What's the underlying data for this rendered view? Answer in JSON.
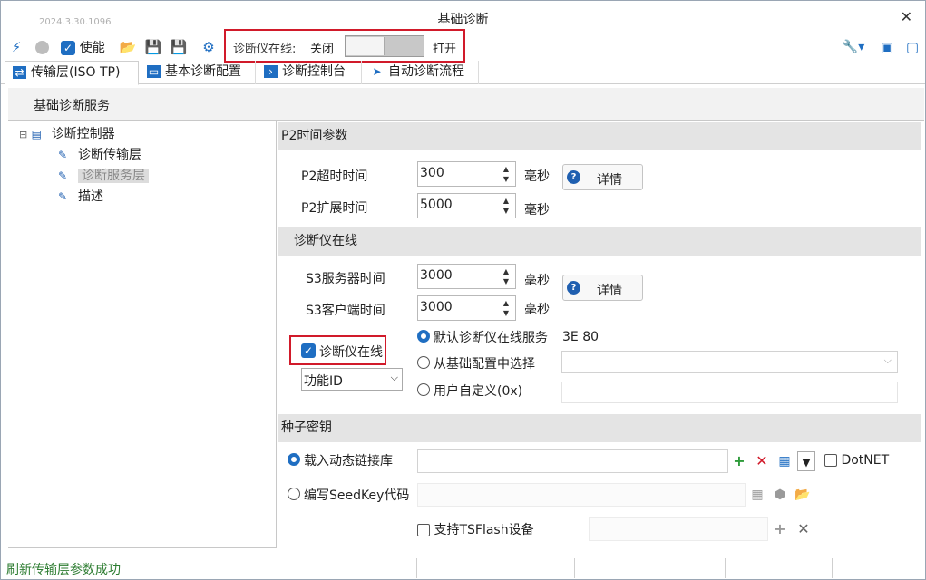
{
  "window": {
    "version": "2024.3.30.1096",
    "title": "基础诊断",
    "close": "✕"
  },
  "toolbar": {
    "enable_label": "使能",
    "online_label": "诊断仪在线:",
    "online_off": "关闭",
    "online_on": "打开"
  },
  "tabs": [
    {
      "label": "传输层(ISO TP)",
      "icon": "transfer-icon"
    },
    {
      "label": "基本诊断配置",
      "icon": "window-icon"
    },
    {
      "label": "诊断控制台",
      "icon": "terminal-icon"
    },
    {
      "label": "自动诊断流程",
      "icon": "send-icon"
    }
  ],
  "group_title": "基础诊断服务",
  "tree": {
    "root": "诊断控制器",
    "children": [
      "诊断传输层",
      "诊断服务层",
      "描述"
    ],
    "selected": "诊断服务层"
  },
  "p2": {
    "section": "P2时间参数",
    "timeout_label": "P2超时时间",
    "timeout_value": "300",
    "ext_label": "P2扩展时间",
    "ext_value": "5000",
    "unit": "毫秒",
    "detail": "详情"
  },
  "tester": {
    "section": "诊断仪在线",
    "s3server_label": "S3服务器时间",
    "s3server_value": "3000",
    "s3client_label": "S3客户端时间",
    "s3client_value": "3000",
    "unit": "毫秒",
    "detail": "详情",
    "enable_label": "诊断仪在线",
    "func_combo": "功能ID",
    "opt_default": "默认诊断仪在线服务",
    "opt_default_value": "3E 80",
    "opt_from_config": "从基础配置中选择",
    "opt_custom": "用户自定义(0x)"
  },
  "seed": {
    "section": "种子密钥",
    "opt_dll": "载入动态链接库",
    "dotnet": "DotNET",
    "opt_code": "编写SeedKey代码",
    "tsflash": "支持TSFlash设备"
  },
  "status": {
    "message": "刷新传输层参数成功"
  },
  "colors": {
    "accent": "#1f6ec2",
    "highlight_box": "#d11a2a",
    "status_ok": "#2e7d32"
  }
}
